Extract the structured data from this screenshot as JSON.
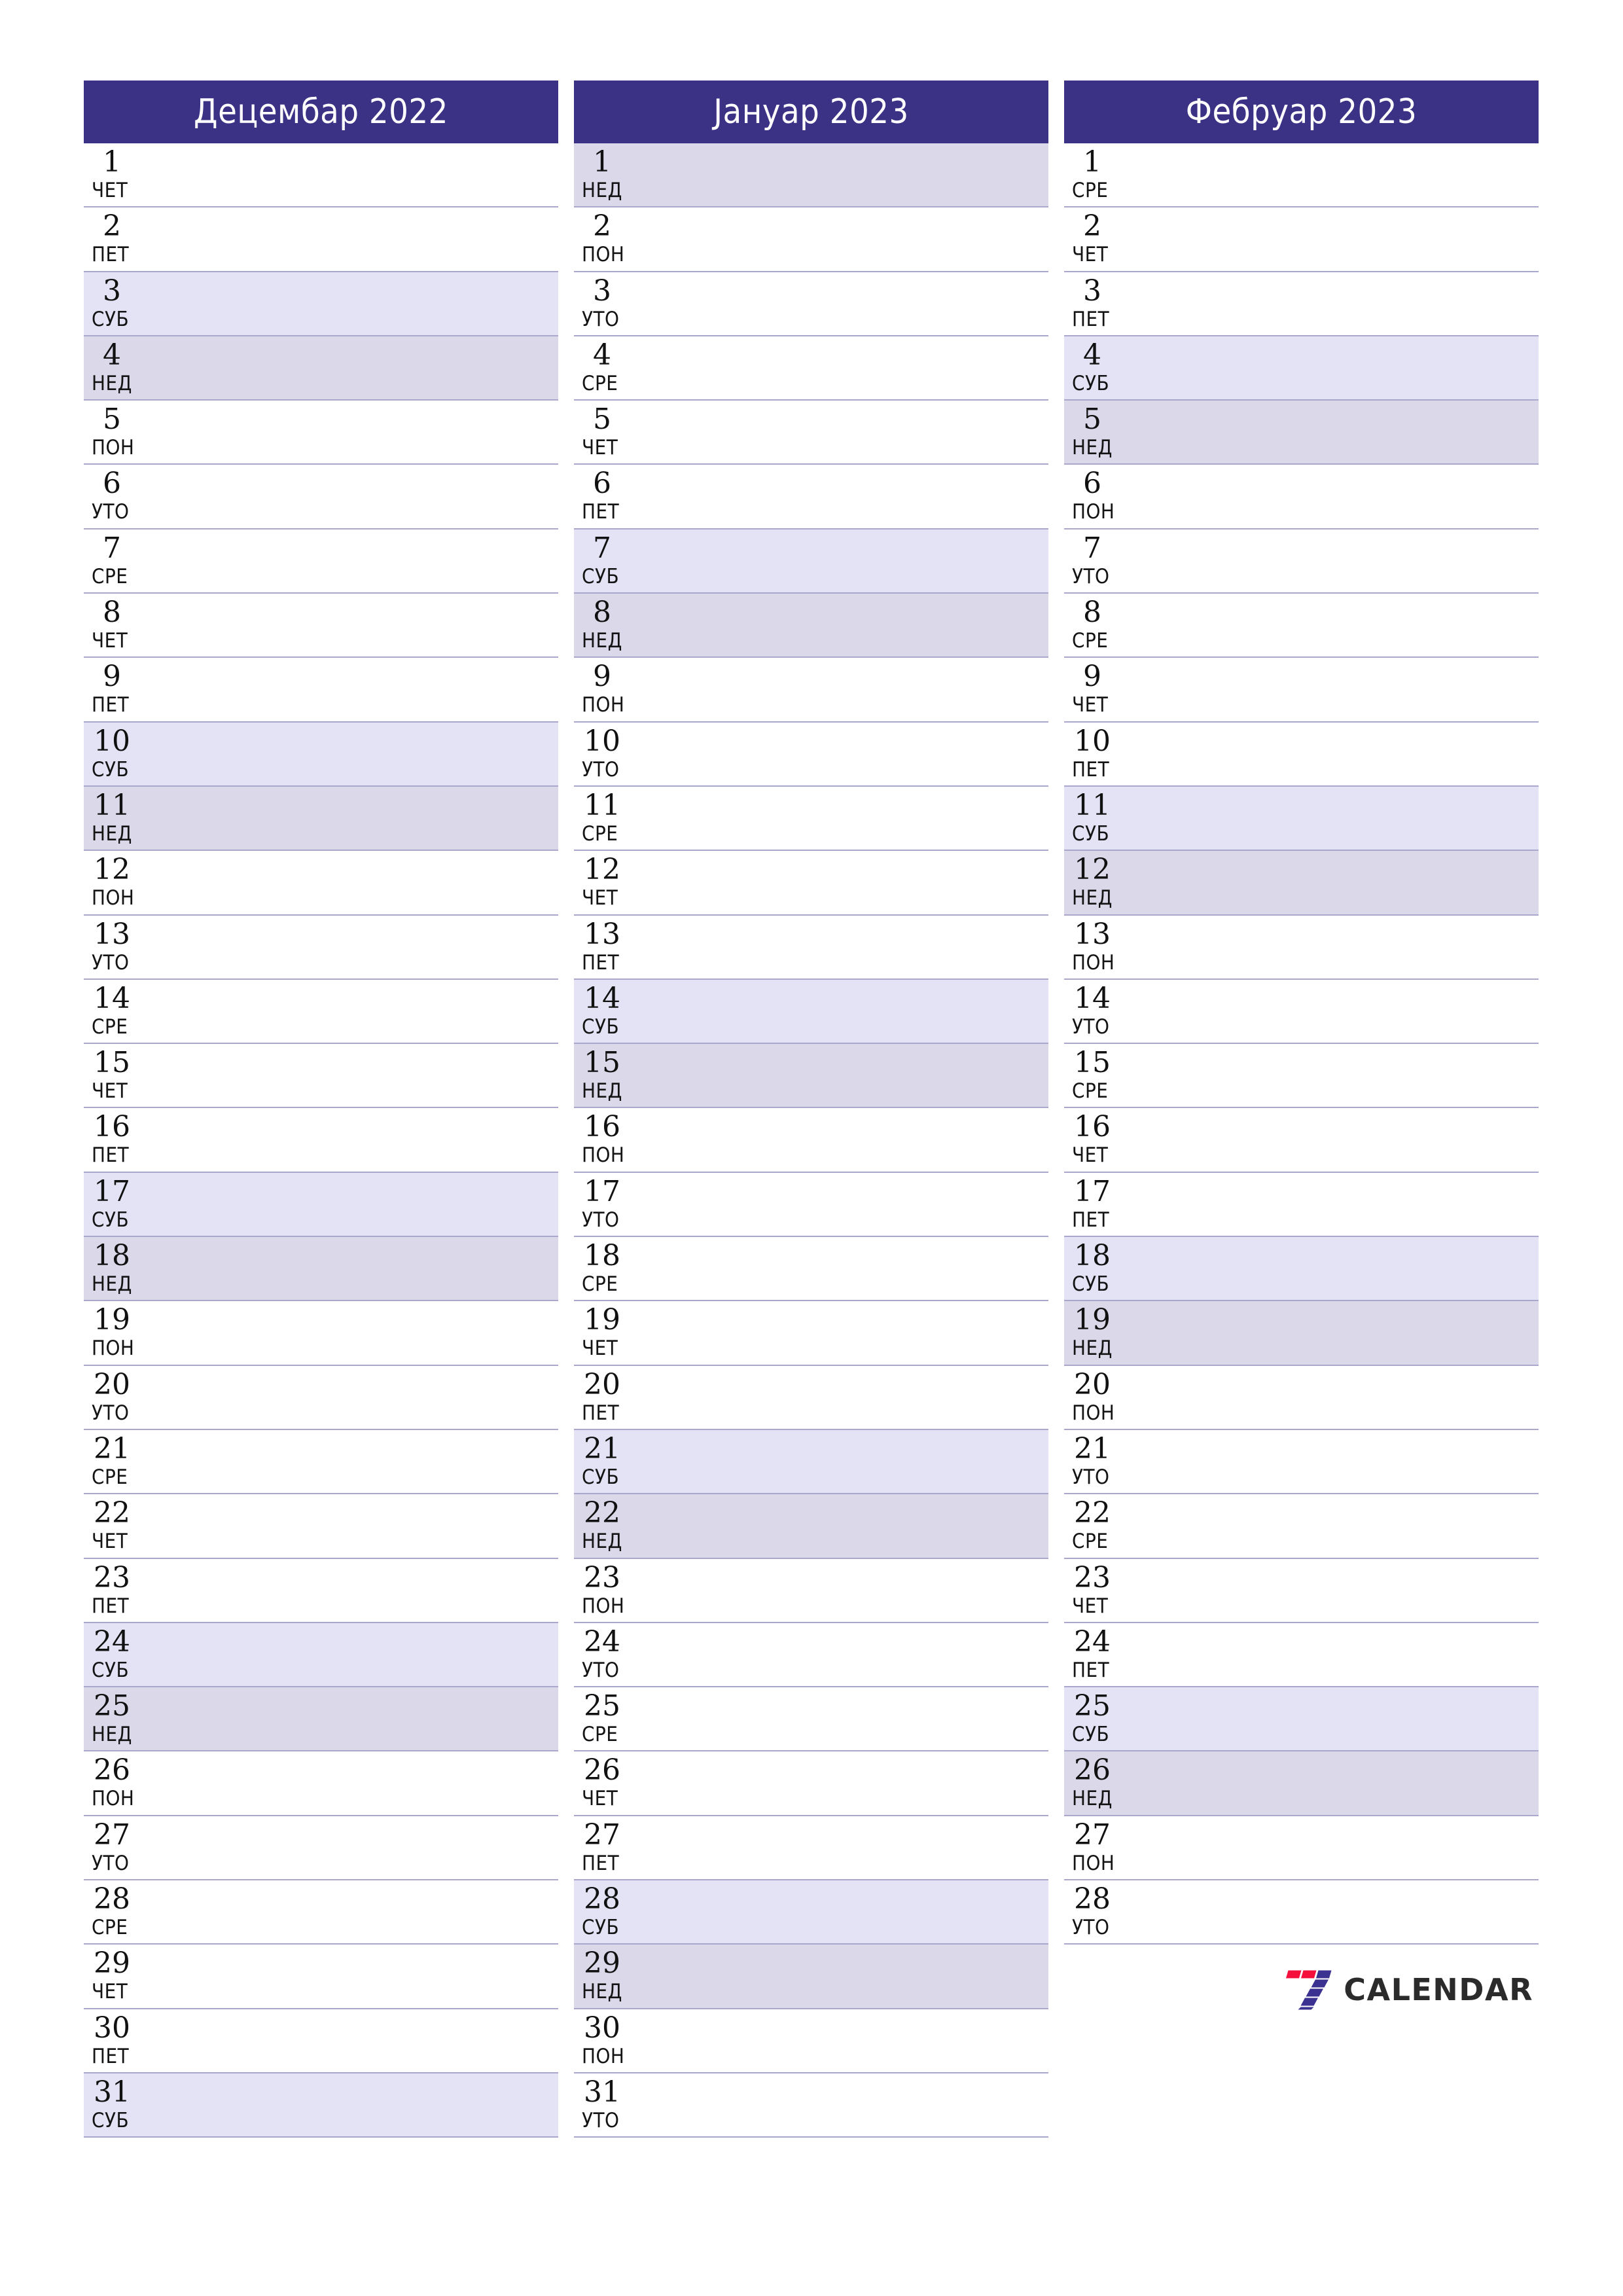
{
  "theme": {
    "header_bg": "#3b3185",
    "header_text": "#ffffff",
    "saturday_bg": "#e3e3f5",
    "sunday_bg": "#dad8e9",
    "row_divider": "#a9a8cc",
    "logo_red": "#f40f3c",
    "logo_purple": "#3b3190",
    "logo_text_color": "#2b2b2b"
  },
  "logo": {
    "text": "CALENDAR",
    "mark": "seven-mark"
  },
  "months": [
    {
      "title": "Децембар 2022",
      "days": [
        {
          "num": "1",
          "wd": "ЧЕТ",
          "kind": "weekday"
        },
        {
          "num": "2",
          "wd": "ПЕТ",
          "kind": "weekday"
        },
        {
          "num": "3",
          "wd": "СУБ",
          "kind": "sat"
        },
        {
          "num": "4",
          "wd": "НЕД",
          "kind": "sun"
        },
        {
          "num": "5",
          "wd": "ПОН",
          "kind": "weekday"
        },
        {
          "num": "6",
          "wd": "УТО",
          "kind": "weekday"
        },
        {
          "num": "7",
          "wd": "СРЕ",
          "kind": "weekday"
        },
        {
          "num": "8",
          "wd": "ЧЕТ",
          "kind": "weekday"
        },
        {
          "num": "9",
          "wd": "ПЕТ",
          "kind": "weekday"
        },
        {
          "num": "10",
          "wd": "СУБ",
          "kind": "sat"
        },
        {
          "num": "11",
          "wd": "НЕД",
          "kind": "sun"
        },
        {
          "num": "12",
          "wd": "ПОН",
          "kind": "weekday"
        },
        {
          "num": "13",
          "wd": "УТО",
          "kind": "weekday"
        },
        {
          "num": "14",
          "wd": "СРЕ",
          "kind": "weekday"
        },
        {
          "num": "15",
          "wd": "ЧЕТ",
          "kind": "weekday"
        },
        {
          "num": "16",
          "wd": "ПЕТ",
          "kind": "weekday"
        },
        {
          "num": "17",
          "wd": "СУБ",
          "kind": "sat"
        },
        {
          "num": "18",
          "wd": "НЕД",
          "kind": "sun"
        },
        {
          "num": "19",
          "wd": "ПОН",
          "kind": "weekday"
        },
        {
          "num": "20",
          "wd": "УТО",
          "kind": "weekday"
        },
        {
          "num": "21",
          "wd": "СРЕ",
          "kind": "weekday"
        },
        {
          "num": "22",
          "wd": "ЧЕТ",
          "kind": "weekday"
        },
        {
          "num": "23",
          "wd": "ПЕТ",
          "kind": "weekday"
        },
        {
          "num": "24",
          "wd": "СУБ",
          "kind": "sat"
        },
        {
          "num": "25",
          "wd": "НЕД",
          "kind": "sun"
        },
        {
          "num": "26",
          "wd": "ПОН",
          "kind": "weekday"
        },
        {
          "num": "27",
          "wd": "УТО",
          "kind": "weekday"
        },
        {
          "num": "28",
          "wd": "СРЕ",
          "kind": "weekday"
        },
        {
          "num": "29",
          "wd": "ЧЕТ",
          "kind": "weekday"
        },
        {
          "num": "30",
          "wd": "ПЕТ",
          "kind": "weekday"
        },
        {
          "num": "31",
          "wd": "СУБ",
          "kind": "sat"
        }
      ]
    },
    {
      "title": "Јануар 2023",
      "days": [
        {
          "num": "1",
          "wd": "НЕД",
          "kind": "sun"
        },
        {
          "num": "2",
          "wd": "ПОН",
          "kind": "weekday"
        },
        {
          "num": "3",
          "wd": "УТО",
          "kind": "weekday"
        },
        {
          "num": "4",
          "wd": "СРЕ",
          "kind": "weekday"
        },
        {
          "num": "5",
          "wd": "ЧЕТ",
          "kind": "weekday"
        },
        {
          "num": "6",
          "wd": "ПЕТ",
          "kind": "weekday"
        },
        {
          "num": "7",
          "wd": "СУБ",
          "kind": "sat"
        },
        {
          "num": "8",
          "wd": "НЕД",
          "kind": "sun"
        },
        {
          "num": "9",
          "wd": "ПОН",
          "kind": "weekday"
        },
        {
          "num": "10",
          "wd": "УТО",
          "kind": "weekday"
        },
        {
          "num": "11",
          "wd": "СРЕ",
          "kind": "weekday"
        },
        {
          "num": "12",
          "wd": "ЧЕТ",
          "kind": "weekday"
        },
        {
          "num": "13",
          "wd": "ПЕТ",
          "kind": "weekday"
        },
        {
          "num": "14",
          "wd": "СУБ",
          "kind": "sat"
        },
        {
          "num": "15",
          "wd": "НЕД",
          "kind": "sun"
        },
        {
          "num": "16",
          "wd": "ПОН",
          "kind": "weekday"
        },
        {
          "num": "17",
          "wd": "УТО",
          "kind": "weekday"
        },
        {
          "num": "18",
          "wd": "СРЕ",
          "kind": "weekday"
        },
        {
          "num": "19",
          "wd": "ЧЕТ",
          "kind": "weekday"
        },
        {
          "num": "20",
          "wd": "ПЕТ",
          "kind": "weekday"
        },
        {
          "num": "21",
          "wd": "СУБ",
          "kind": "sat"
        },
        {
          "num": "22",
          "wd": "НЕД",
          "kind": "sun"
        },
        {
          "num": "23",
          "wd": "ПОН",
          "kind": "weekday"
        },
        {
          "num": "24",
          "wd": "УТО",
          "kind": "weekday"
        },
        {
          "num": "25",
          "wd": "СРЕ",
          "kind": "weekday"
        },
        {
          "num": "26",
          "wd": "ЧЕТ",
          "kind": "weekday"
        },
        {
          "num": "27",
          "wd": "ПЕТ",
          "kind": "weekday"
        },
        {
          "num": "28",
          "wd": "СУБ",
          "kind": "sat"
        },
        {
          "num": "29",
          "wd": "НЕД",
          "kind": "sun"
        },
        {
          "num": "30",
          "wd": "ПОН",
          "kind": "weekday"
        },
        {
          "num": "31",
          "wd": "УТО",
          "kind": "weekday"
        }
      ]
    },
    {
      "title": "Фебруар 2023",
      "days": [
        {
          "num": "1",
          "wd": "СРЕ",
          "kind": "weekday"
        },
        {
          "num": "2",
          "wd": "ЧЕТ",
          "kind": "weekday"
        },
        {
          "num": "3",
          "wd": "ПЕТ",
          "kind": "weekday"
        },
        {
          "num": "4",
          "wd": "СУБ",
          "kind": "sat"
        },
        {
          "num": "5",
          "wd": "НЕД",
          "kind": "sun"
        },
        {
          "num": "6",
          "wd": "ПОН",
          "kind": "weekday"
        },
        {
          "num": "7",
          "wd": "УТО",
          "kind": "weekday"
        },
        {
          "num": "8",
          "wd": "СРЕ",
          "kind": "weekday"
        },
        {
          "num": "9",
          "wd": "ЧЕТ",
          "kind": "weekday"
        },
        {
          "num": "10",
          "wd": "ПЕТ",
          "kind": "weekday"
        },
        {
          "num": "11",
          "wd": "СУБ",
          "kind": "sat"
        },
        {
          "num": "12",
          "wd": "НЕД",
          "kind": "sun"
        },
        {
          "num": "13",
          "wd": "ПОН",
          "kind": "weekday"
        },
        {
          "num": "14",
          "wd": "УТО",
          "kind": "weekday"
        },
        {
          "num": "15",
          "wd": "СРЕ",
          "kind": "weekday"
        },
        {
          "num": "16",
          "wd": "ЧЕТ",
          "kind": "weekday"
        },
        {
          "num": "17",
          "wd": "ПЕТ",
          "kind": "weekday"
        },
        {
          "num": "18",
          "wd": "СУБ",
          "kind": "sat"
        },
        {
          "num": "19",
          "wd": "НЕД",
          "kind": "sun"
        },
        {
          "num": "20",
          "wd": "ПОН",
          "kind": "weekday"
        },
        {
          "num": "21",
          "wd": "УТО",
          "kind": "weekday"
        },
        {
          "num": "22",
          "wd": "СРЕ",
          "kind": "weekday"
        },
        {
          "num": "23",
          "wd": "ЧЕТ",
          "kind": "weekday"
        },
        {
          "num": "24",
          "wd": "ПЕТ",
          "kind": "weekday"
        },
        {
          "num": "25",
          "wd": "СУБ",
          "kind": "sat"
        },
        {
          "num": "26",
          "wd": "НЕД",
          "kind": "sun"
        },
        {
          "num": "27",
          "wd": "ПОН",
          "kind": "weekday"
        },
        {
          "num": "28",
          "wd": "УТО",
          "kind": "weekday"
        }
      ]
    }
  ]
}
